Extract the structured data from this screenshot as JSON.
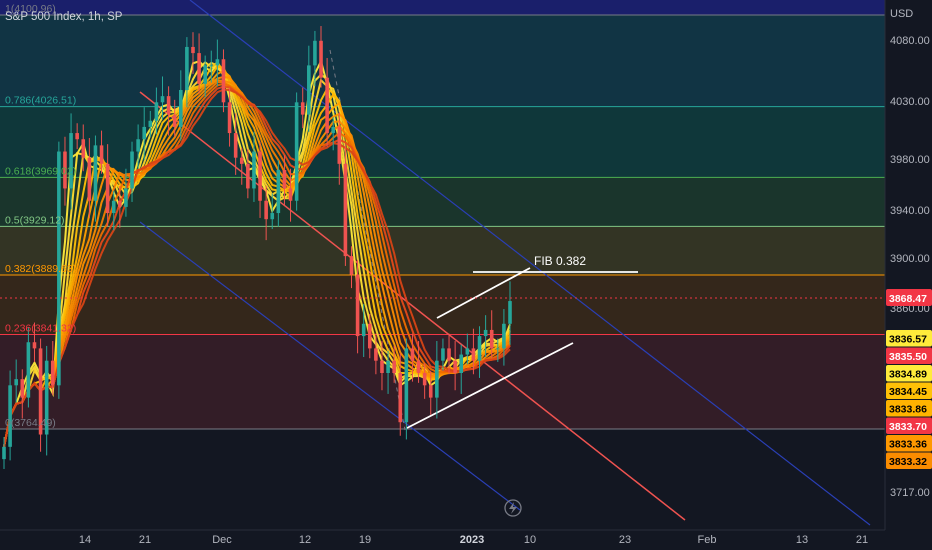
{
  "header": {
    "symbol_title": "S&P 500 Index, 1h, SP",
    "currency": "USD"
  },
  "icons": {
    "replay": "lightning-icon"
  },
  "chart_data": {
    "type": "candlestick",
    "title": "S&P 500 Index, 1h, SP",
    "currency": "USD",
    "y_ticks": [
      4080,
      4030,
      3980,
      3940,
      3900,
      3860,
      3717
    ],
    "y_tick_labels": [
      "4080.00",
      "4030.00",
      "3980.00",
      "3940.00",
      "3900.00",
      "3860.00",
      "3717.00"
    ],
    "x_ticks": [
      "14",
      "21",
      "Dec",
      "12",
      "19",
      "2023",
      "10",
      "23",
      "Feb",
      "13",
      "21"
    ],
    "last_price": "3868.47",
    "fib_levels": [
      {
        "ratio": "1",
        "label": "1(4100.96)",
        "price": 4100.96,
        "color": "#787b86"
      },
      {
        "ratio": "0.786",
        "label": "0.786(4026.51)",
        "price": 4026.51,
        "color": "#26a69a"
      },
      {
        "ratio": "0.618",
        "label": "0.618(3969.02)",
        "price": 3969.02,
        "color": "#4caf50"
      },
      {
        "ratio": "0.5",
        "label": "0.5(3929.12)",
        "price": 3929.12,
        "color": "#81c784"
      },
      {
        "ratio": "0.382",
        "label": "0.382(3889.63)",
        "price": 3889.63,
        "color": "#ff9800"
      },
      {
        "ratio": "0.236",
        "label": "0.236(3841.32)",
        "price": 3841.32,
        "color": "#f23645"
      },
      {
        "ratio": "0",
        "label": "0(3764.49)",
        "price": 3764.49,
        "color": "#787b86"
      }
    ],
    "annotations": [
      {
        "text": "FIB 0.382"
      }
    ],
    "ribbon_price_tags": [
      {
        "value": "3836.57",
        "bg": "#ffeb3b",
        "fg": "#000000"
      },
      {
        "value": "3835.50",
        "bg": "#f23645",
        "fg": "#ffffff"
      },
      {
        "value": "3834.89",
        "bg": "#ffeb3b",
        "fg": "#000000"
      },
      {
        "value": "3834.45",
        "bg": "#ffc107",
        "fg": "#000000"
      },
      {
        "value": "3833.86",
        "bg": "#ffb300",
        "fg": "#000000"
      },
      {
        "value": "3833.70",
        "bg": "#f23645",
        "fg": "#ffffff"
      },
      {
        "value": "3833.36",
        "bg": "#ff9800",
        "fg": "#000000"
      },
      {
        "value": "3833.32",
        "bg": "#fb8c00",
        "fg": "#000000"
      }
    ],
    "series": [
      {
        "name": "Close",
        "values": [
          3750,
          3800,
          3805,
          3790,
          3835,
          3830,
          3760,
          3820,
          3800,
          3990,
          3960,
          4005,
          4000,
          3985,
          3950,
          3995,
          3980,
          3940,
          3950,
          3945,
          3960,
          3990,
          4000,
          4010,
          4015,
          4030,
          4035,
          4020,
          4010,
          4040,
          4075,
          4070,
          4045,
          4060,
          4060,
          4065,
          4030,
          4005,
          3985,
          3980,
          3960,
          3990,
          3950,
          3935,
          3940,
          3975,
          3960,
          3950,
          4030,
          4020,
          4060,
          4080,
          4050,
          4005,
          4010,
          3980,
          3905,
          3890,
          3840,
          3850,
          3830,
          3820,
          3810,
          3820,
          3810,
          3770,
          3830,
          3820,
          3810,
          3800,
          3790,
          3820,
          3830,
          3820,
          3810,
          3825,
          3830,
          3820,
          3840,
          3845,
          3830,
          3830,
          3850,
          3868.47
        ]
      }
    ]
  }
}
